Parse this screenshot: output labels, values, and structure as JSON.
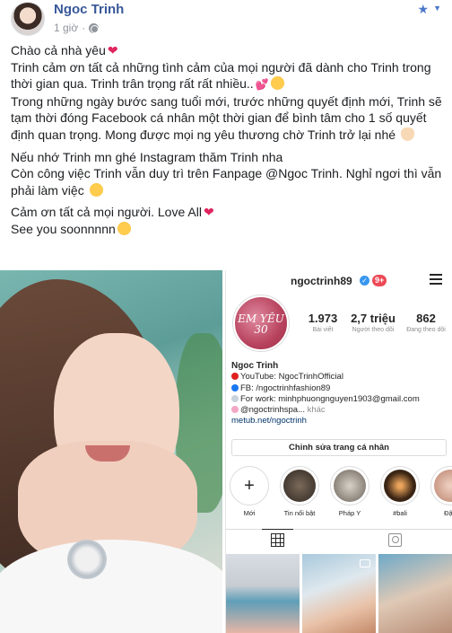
{
  "post": {
    "author": "Ngoc Trinh",
    "time": "1 giờ",
    "paragraphs": {
      "p1_l1": "Chào cả nhà yêu",
      "p1_l2": "Trinh cảm ơn tất cả những tình cảm của mọi người đã dành cho Trinh trong thời gian qua. Trinh trân trọng rất rất nhiều..",
      "p1_l3": "Trong những ngày bước sang tuổi mới, trước những quyết định mới, Trinh sẽ tạm thời đóng Facebook cá nhân một thời gian để bình tâm cho 1 số quyết định quan trọng. Mong được mọi ng yêu thương chờ Trinh trở lại nhé",
      "p2_l1": "Nếu nhớ Trinh mn ghé Instagram thăm Trinh nha",
      "p2_l2": "Còn công việc Trinh vẫn duy trì trên Fanpage @Ngoc Trinh. Nghỉ ngơi thì vẫn phải làm việc",
      "p3_l1": "Cảm ơn tất cả mọi người. Love All",
      "p3_l2": "See you soonnnnn"
    }
  },
  "instagram": {
    "username": "ngoctrinh89",
    "notif_badge": "9+",
    "avatar_text": "EM YÊU 30",
    "stats": [
      {
        "num": "1.973",
        "label": "Bài viết"
      },
      {
        "num": "2,7 triệu",
        "label": "Người theo dõi"
      },
      {
        "num": "862",
        "label": "Đang theo dõi"
      }
    ],
    "bio": {
      "name": "Ngoc Trinh",
      "youtube": "YouTube: NgocTrinhOfficial",
      "fb": "FB: /ngoctrinhfashion89",
      "work": "For work: minhphuongnguyen1903@gmail.com",
      "mention": "@ngoctrinhspa...",
      "more": "khác",
      "link": "metub.net/ngoctrinh"
    },
    "edit_button": "Chỉnh sửa trang cá nhân",
    "highlights": [
      {
        "label": "Mới"
      },
      {
        "label": "Tin nổi bật"
      },
      {
        "label": "Pháp Y"
      },
      {
        "label": "#bali"
      },
      {
        "label": "Đập"
      }
    ]
  },
  "colors": {
    "fb_link": "#385898",
    "ig_blue": "#3897f0",
    "ig_red": "#ed4956"
  }
}
